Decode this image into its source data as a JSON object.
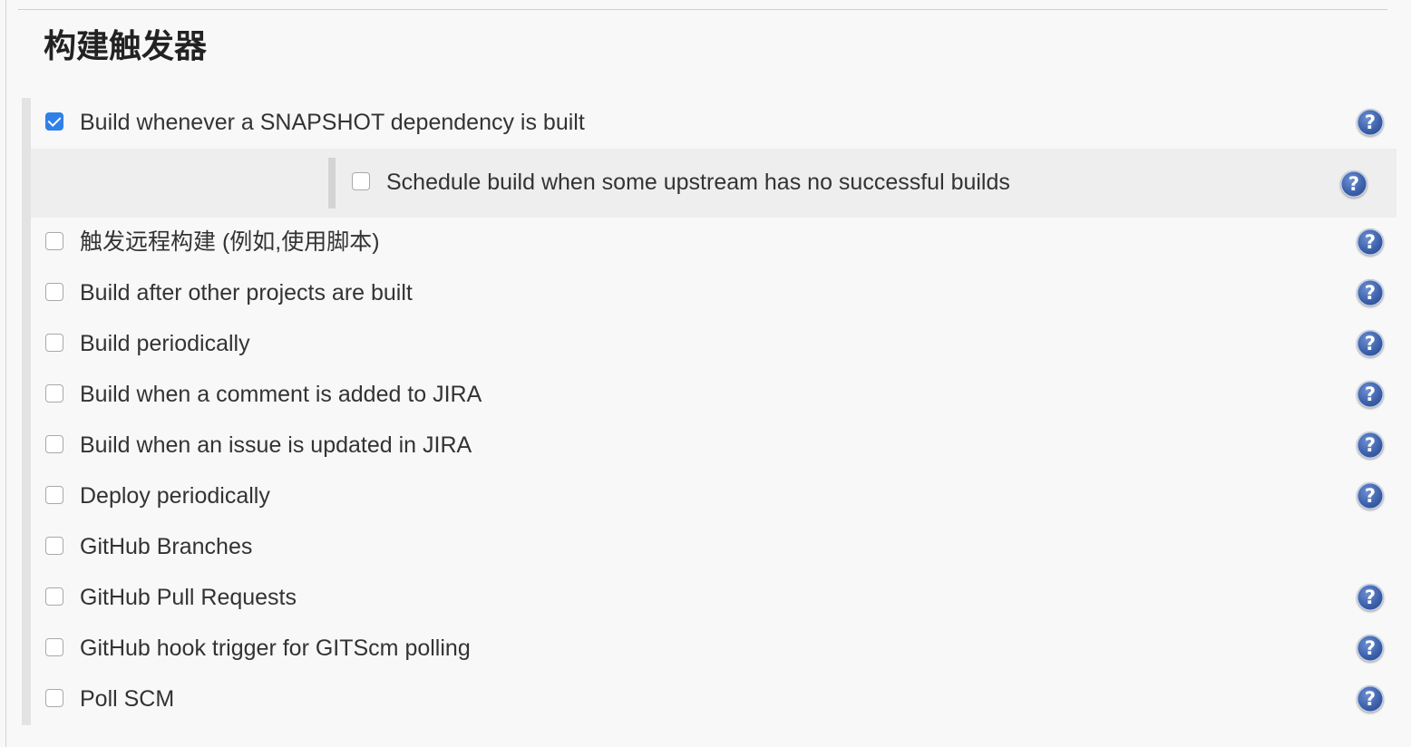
{
  "section": {
    "title": "构建触发器"
  },
  "triggers": [
    {
      "label": "Build whenever a SNAPSHOT dependency is built",
      "checked": true,
      "help": true
    },
    {
      "label": "触发远程构建 (例如,使用脚本)",
      "checked": false,
      "help": true
    },
    {
      "label": "Build after other projects are built",
      "checked": false,
      "help": true
    },
    {
      "label": "Build periodically",
      "checked": false,
      "help": true
    },
    {
      "label": "Build when a comment is added to JIRA",
      "checked": false,
      "help": true
    },
    {
      "label": "Build when an issue is updated in JIRA",
      "checked": false,
      "help": true
    },
    {
      "label": "Deploy periodically",
      "checked": false,
      "help": true
    },
    {
      "label": "GitHub Branches",
      "checked": false,
      "help": false
    },
    {
      "label": "GitHub Pull Requests",
      "checked": false,
      "help": true
    },
    {
      "label": "GitHub hook trigger for GITScm polling",
      "checked": false,
      "help": true
    },
    {
      "label": "Poll SCM",
      "checked": false,
      "help": true
    }
  ],
  "snapshot_option": {
    "label": "Schedule build when some upstream has no successful builds",
    "checked": false
  },
  "colors": {
    "checkbox_checked": "#2f80e8",
    "help_icon": "#3a5ea8"
  },
  "icons": {
    "help": "help-icon",
    "check": "checkmark-icon"
  }
}
